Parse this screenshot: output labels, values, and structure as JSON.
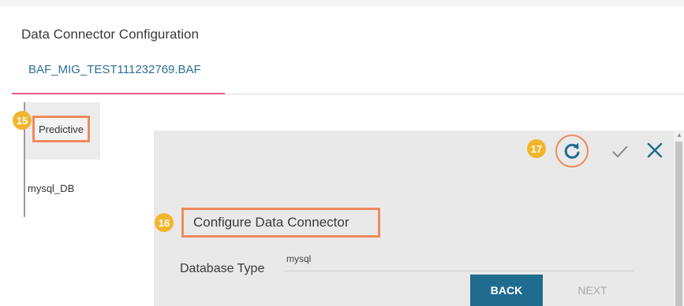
{
  "header": {
    "title": "Data Connector Configuration"
  },
  "tabs": [
    {
      "label": "BAF_MIG_TEST111232769.BAF",
      "active": true
    }
  ],
  "sidebar": {
    "items": [
      {
        "label": "Predictive",
        "active": true
      },
      {
        "label": "mysql_DB",
        "active": false
      }
    ]
  },
  "callouts": {
    "predictive": "15",
    "configure": "16",
    "refresh": "17"
  },
  "panel": {
    "section_title": "Configure Data Connector",
    "fields": {
      "database_type": {
        "label": "Database Type",
        "value": "mysql"
      }
    },
    "buttons": {
      "back": "BACK",
      "next": "NEXT"
    },
    "icons": {
      "refresh": "refresh-icon",
      "confirm": "check-icon",
      "close": "close-icon"
    }
  },
  "colors": {
    "accent": "#1f6c8f",
    "tab_underline": "#e45a8c",
    "highlight": "#f08a5d",
    "badge": "#f3b52c"
  }
}
